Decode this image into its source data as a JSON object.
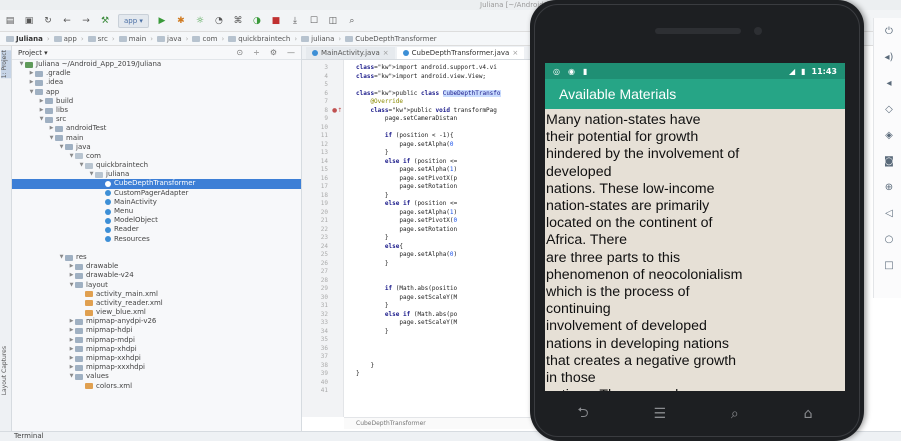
{
  "window": {
    "title": "Juliana [~/AndroidStudioProjects/Juliana]"
  },
  "toolbar": {
    "run_config": "app"
  },
  "breadcrumb": [
    "Juliana",
    "app",
    "src",
    "main",
    "java",
    "com",
    "quickbraintech",
    "juliana",
    "CubeDepthTransformer"
  ],
  "left_tabs": {
    "project": "1: Project",
    "captures": "Layout Captures"
  },
  "project_panel": {
    "view": "Project",
    "tree": [
      {
        "label": "Juliana  ~/Android_App_2019/Juliana",
        "depth": 0,
        "type": "mod",
        "arrow": "open"
      },
      {
        "label": ".gradle",
        "depth": 1,
        "type": "folder",
        "arrow": "closed"
      },
      {
        "label": ".idea",
        "depth": 1,
        "type": "folder",
        "arrow": "closed"
      },
      {
        "label": "app",
        "depth": 1,
        "type": "folder",
        "arrow": "open"
      },
      {
        "label": "build",
        "depth": 2,
        "type": "folder",
        "arrow": "closed"
      },
      {
        "label": "libs",
        "depth": 2,
        "type": "folder",
        "arrow": "closed"
      },
      {
        "label": "src",
        "depth": 2,
        "type": "folder",
        "arrow": "open"
      },
      {
        "label": "androidTest",
        "depth": 3,
        "type": "folder",
        "arrow": "closed"
      },
      {
        "label": "main",
        "depth": 3,
        "type": "folder",
        "arrow": "open"
      },
      {
        "label": "java",
        "depth": 4,
        "type": "folder",
        "arrow": "open"
      },
      {
        "label": "com",
        "depth": 5,
        "type": "pkg",
        "arrow": "open"
      },
      {
        "label": "quickbraintech",
        "depth": 6,
        "type": "pkg",
        "arrow": "open"
      },
      {
        "label": "juliana",
        "depth": 7,
        "type": "pkg",
        "arrow": "open"
      },
      {
        "label": "CubeDepthTransformer",
        "depth": 8,
        "type": "cls",
        "arrow": "",
        "selected": true
      },
      {
        "label": "CustomPagerAdapter",
        "depth": 8,
        "type": "cls",
        "arrow": ""
      },
      {
        "label": "MainActivity",
        "depth": 8,
        "type": "cls",
        "arrow": ""
      },
      {
        "label": "Menu",
        "depth": 8,
        "type": "cls",
        "arrow": ""
      },
      {
        "label": "ModelObject",
        "depth": 8,
        "type": "cls",
        "arrow": ""
      },
      {
        "label": "Reader",
        "depth": 8,
        "type": "cls",
        "arrow": ""
      },
      {
        "label": "Resources",
        "depth": 8,
        "type": "cls",
        "arrow": ""
      },
      {
        "label": "",
        "depth": 0,
        "type": "none",
        "arrow": ""
      },
      {
        "label": "res",
        "depth": 4,
        "type": "folder",
        "arrow": "open"
      },
      {
        "label": "drawable",
        "depth": 5,
        "type": "folder",
        "arrow": "closed"
      },
      {
        "label": "drawable-v24",
        "depth": 5,
        "type": "folder",
        "arrow": "closed"
      },
      {
        "label": "layout",
        "depth": 5,
        "type": "folder",
        "arrow": "open"
      },
      {
        "label": "activity_main.xml",
        "depth": 6,
        "type": "xml",
        "arrow": ""
      },
      {
        "label": "activity_reader.xml",
        "depth": 6,
        "type": "xml",
        "arrow": ""
      },
      {
        "label": "view_blue.xml",
        "depth": 6,
        "type": "xml",
        "arrow": ""
      },
      {
        "label": "mipmap-anydpi-v26",
        "depth": 5,
        "type": "folder",
        "arrow": "closed"
      },
      {
        "label": "mipmap-hdpi",
        "depth": 5,
        "type": "folder",
        "arrow": "closed"
      },
      {
        "label": "mipmap-mdpi",
        "depth": 5,
        "type": "folder",
        "arrow": "closed"
      },
      {
        "label": "mipmap-xhdpi",
        "depth": 5,
        "type": "folder",
        "arrow": "closed"
      },
      {
        "label": "mipmap-xxhdpi",
        "depth": 5,
        "type": "folder",
        "arrow": "closed"
      },
      {
        "label": "mipmap-xxxhdpi",
        "depth": 5,
        "type": "folder",
        "arrow": "closed"
      },
      {
        "label": "values",
        "depth": 5,
        "type": "folder",
        "arrow": "open"
      },
      {
        "label": "colors.xml",
        "depth": 6,
        "type": "xml",
        "arrow": ""
      }
    ]
  },
  "editor": {
    "tabs": [
      {
        "label": "MainActivity.java",
        "active": false
      },
      {
        "label": "CubeDepthTransformer.java",
        "active": true
      }
    ],
    "line_numbers": [
      "3",
      "4",
      "5",
      "6",
      "7",
      "8",
      "9",
      "10",
      "11",
      "12",
      "13",
      "14",
      "15",
      "16",
      "17",
      "18",
      "19",
      "20",
      "21",
      "22",
      "23",
      "24",
      "25",
      "26",
      "27",
      "28",
      "29",
      "30",
      "31",
      "32",
      "33",
      "34",
      "35",
      "36",
      "37",
      "38",
      "39",
      "40",
      "41"
    ],
    "code_lines": [
      {
        "text": "import android.support.v4.vi",
        "kind": "import"
      },
      {
        "text": "import android.view.View;",
        "kind": "import"
      },
      {
        "text": "",
        "kind": "plain"
      },
      {
        "text": "public class CubeDepthTransfo",
        "kind": "class"
      },
      {
        "text": "    @Override",
        "kind": "ann"
      },
      {
        "text": "    public void transformPag",
        "kind": "method"
      },
      {
        "text": "        page.setCameraDistan",
        "kind": "plain"
      },
      {
        "text": "",
        "kind": "plain"
      },
      {
        "text": "        if (position < -1){",
        "kind": "if"
      },
      {
        "text": "            page.setAlpha(0",
        "kind": "plain"
      },
      {
        "text": "        }",
        "kind": "plain"
      },
      {
        "text": "        else if (position <=",
        "kind": "if"
      },
      {
        "text": "            page.setAlpha(1)",
        "kind": "plain"
      },
      {
        "text": "            page.setPivotX(p",
        "kind": "plain"
      },
      {
        "text": "            page.setRotation",
        "kind": "plain"
      },
      {
        "text": "        }",
        "kind": "plain"
      },
      {
        "text": "        else if (position <=",
        "kind": "if"
      },
      {
        "text": "            page.setAlpha(1)",
        "kind": "plain"
      },
      {
        "text": "            page.setPivotX(0",
        "kind": "plain"
      },
      {
        "text": "            page.setRotation",
        "kind": "plain"
      },
      {
        "text": "        }",
        "kind": "plain"
      },
      {
        "text": "        else{",
        "kind": "if"
      },
      {
        "text": "            page.setAlpha(0)",
        "kind": "plain"
      },
      {
        "text": "        }",
        "kind": "plain"
      },
      {
        "text": "",
        "kind": "plain"
      },
      {
        "text": "",
        "kind": "plain"
      },
      {
        "text": "        if (Math.abs(positio",
        "kind": "if"
      },
      {
        "text": "            page.setScaleY(M",
        "kind": "plain"
      },
      {
        "text": "        }",
        "kind": "plain"
      },
      {
        "text": "        else if (Math.abs(po",
        "kind": "if"
      },
      {
        "text": "            page.setScaleY(M",
        "kind": "plain"
      },
      {
        "text": "        }",
        "kind": "plain"
      },
      {
        "text": "",
        "kind": "plain"
      },
      {
        "text": "",
        "kind": "plain"
      },
      {
        "text": "",
        "kind": "plain"
      },
      {
        "text": "    }",
        "kind": "plain"
      },
      {
        "text": "}",
        "kind": "plain"
      }
    ],
    "status_file": "CubeDepthTransformer"
  },
  "bottom": {
    "terminal_label": "Terminal"
  },
  "phone": {
    "status_time": "11:43",
    "app_title": "Available Materials",
    "body_lines": [
      "Many nation-states have",
      "their potential for growth",
      "hindered by the involvement of",
      "developed",
      "nations. These low-income",
      "nation-states are primarily",
      "located on the continent of",
      "Africa. There",
      "are three parts to this",
      "phenomenon of neocolonialism",
      "which is the process of",
      "continuing",
      "involvement of developed",
      "nations in developing nations",
      "that creates a negative growth",
      "in those",
      "nations. The research"
    ],
    "nav_icons": [
      "back-icon",
      "recents-icon",
      "search-icon",
      "home-icon"
    ],
    "colors": {
      "appbar": "#26a586",
      "statusbar": "#1f8f74",
      "screen_bg": "#e6e0d6"
    }
  },
  "emulator_sidebar_icons": [
    "power-icon",
    "volume-up-icon",
    "volume-down-icon",
    "rotate-left-icon",
    "rotate-right-icon",
    "camera-icon",
    "zoom-icon",
    "back-icon",
    "home-circle-icon",
    "overview-icon"
  ]
}
